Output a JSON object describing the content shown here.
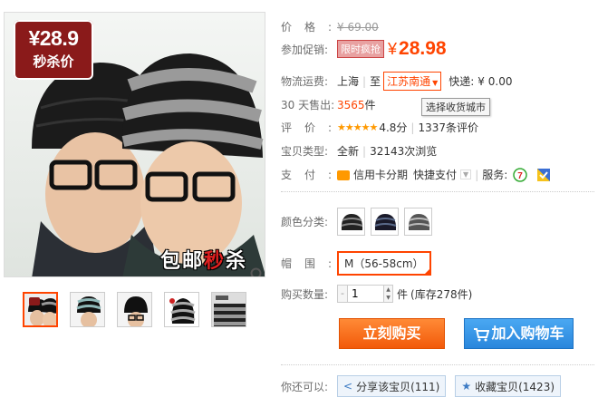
{
  "gallery": {
    "badge_price": "¥28.9",
    "badge_text": "秒杀价",
    "overlay_left": "包邮",
    "overlay_red": "秒",
    "overlay_right": "杀",
    "thumbnails": [
      "thumb-1",
      "thumb-2",
      "thumb-3",
      "thumb-4",
      "thumb-5"
    ]
  },
  "price": {
    "label": "价格:",
    "original": "¥ 69.00"
  },
  "promo": {
    "label": "参加促销:",
    "tag": "限时疯抢",
    "yen": "¥",
    "value": "28.98"
  },
  "shipping": {
    "label": "物流运费:",
    "from": "上海",
    "to_word": "至",
    "dest": "江苏南通",
    "express": "快递:",
    "fee": "¥ 0.00",
    "tooltip": "选择收货城市"
  },
  "sales": {
    "label": "30 天售出:",
    "count": "3565",
    "unit": "件"
  },
  "rating": {
    "label": "评价:",
    "stars": "★★★★★",
    "score": "4.8分",
    "reviews": "1337条评价"
  },
  "type": {
    "label": "宝贝类型:",
    "value": "全新",
    "views": "32143次浏览"
  },
  "payment": {
    "label": "支付:",
    "credit": "信用卡分期",
    "quick": "快捷支付",
    "service": "服务:"
  },
  "color": {
    "label": "颜色分类:"
  },
  "size": {
    "label": "帽围:",
    "selected": "M（56-58cm）"
  },
  "quantity": {
    "label": "购买数量:",
    "minus": "-",
    "value": "1",
    "unit": "件",
    "stock": "(库存278件)"
  },
  "actions": {
    "buy": "立刻购买",
    "cart": "加入购物车"
  },
  "share": {
    "label": "你还可以:",
    "share_btn": "分享该宝贝(111)",
    "fav_btn": "收藏宝贝(1423)"
  },
  "colors": {
    "accent": "#ff4400",
    "buy": "#f25a0a",
    "cart": "#2a86dc"
  }
}
